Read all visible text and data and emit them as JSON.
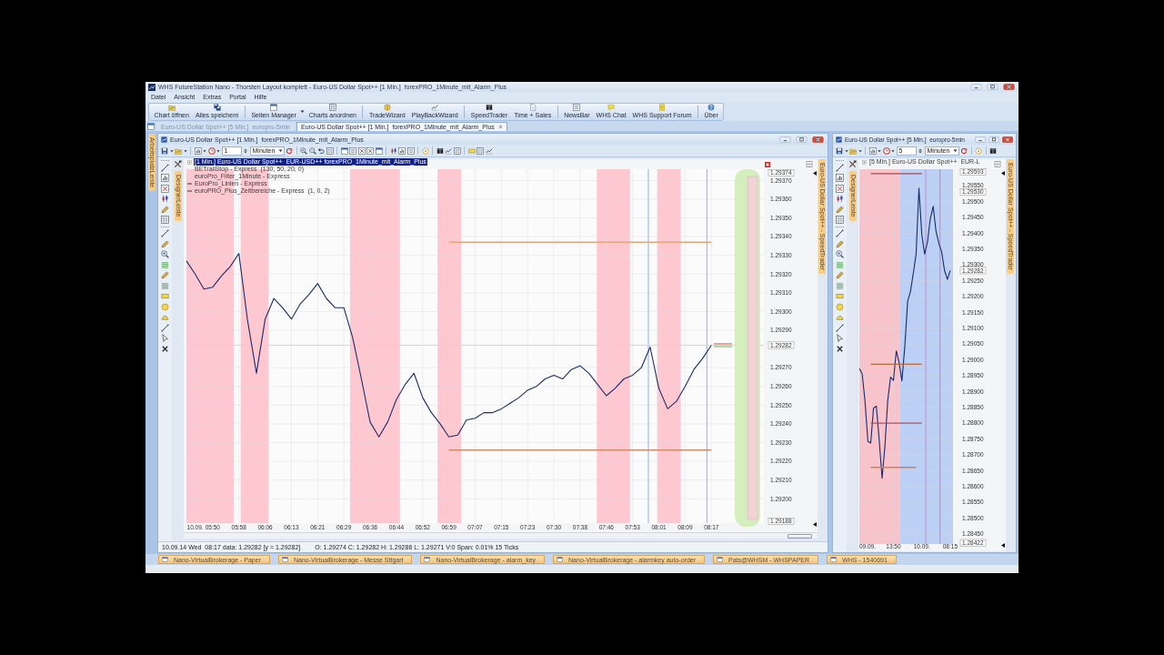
{
  "window": {
    "title": "WHS FutureStation Nano - Thorsten Layout komplett - Euro-US Dollar Spot++ [1 Min.]  forexPRO_1Minute_mit_Alarm_Plus"
  },
  "menu": [
    "Datei",
    "Ansicht",
    "Extras",
    "Portal",
    "Hilfe"
  ],
  "toolbar": [
    {
      "items": [
        {
          "label": "Chart öffnen",
          "dropdown": false
        },
        {
          "label": "Alles speichern",
          "dropdown": false
        }
      ]
    },
    {
      "items": [
        {
          "label": "Seiten Manager",
          "dropdown": true
        },
        {
          "label": "Charts anordnen",
          "dropdown": false
        }
      ]
    },
    {
      "items": [
        {
          "label": "TradeWizard",
          "dropdown": false
        },
        {
          "label": "PlayBackWizard",
          "dropdown": false
        }
      ]
    },
    {
      "items": [
        {
          "label": "SpeedTrader",
          "dropdown": false
        },
        {
          "label": "Time + Sales",
          "dropdown": false
        }
      ]
    },
    {
      "items": [
        {
          "label": "NewsBar",
          "dropdown": false
        },
        {
          "label": "WHS Chat",
          "dropdown": false
        },
        {
          "label": "WHS Support Forum",
          "dropdown": false
        }
      ]
    },
    {
      "items": [
        {
          "label": "Über",
          "dropdown": false
        }
      ]
    }
  ],
  "tabs": [
    {
      "label": "Euro-US Dollar Spot++ [5 Min.]  europro-5min",
      "selected": false
    },
    {
      "label": "Euro-US Dollar Spot++ [1 Min.]  forexPRO_1Minute_mit_Alarm_Plus",
      "selected": true
    }
  ],
  "workspace_bar": {
    "label": "ArbeitsplatzLeiste"
  },
  "charts": [
    {
      "title": "Euro-US Dollar Spot++ [1 Min.]  forexPRO_1Minute_mit_Alarm_Plus",
      "interval": "1",
      "unit": "Minuten",
      "designer_tab": "DesignerLeiste",
      "side_tab": "Euro-US Dollar Spot++ - SpeedTrader",
      "ladder": true,
      "legend": [
        {
          "kind": "instrument",
          "text": "[1 Min.] Euro-US Dollar Spot++  EUR-USD++ forexPRO_1Minute_mit_Alarm_Plus",
          "selected": true,
          "swatch": false
        },
        {
          "kind": "indicator",
          "text": "BETrailStop - Express  (130, 50, 20, 0)",
          "selected": false,
          "swatch": false
        },
        {
          "kind": "indicator",
          "text": "euroPro_Filter_1Minute - Express",
          "selected": false,
          "swatch": false
        },
        {
          "kind": "indicator",
          "text": "EuroPro_Linien - Express",
          "selected": false,
          "swatch": true
        },
        {
          "kind": "indicator",
          "text": "euroPRO_Plus_Zeitbereiche - Express  (1, 0, 2)",
          "selected": false,
          "swatch": true
        }
      ],
      "chart_data": {
        "type": "line",
        "grid": true,
        "categories": [
          null,
          "10.09.",
          null,
          "05:50",
          null,
          null,
          "05:58",
          null,
          null,
          "06:06",
          null,
          null,
          "06:13",
          null,
          null,
          "06:21",
          null,
          null,
          "06:29",
          null,
          null,
          "06:36",
          null,
          null,
          "06:44",
          null,
          null,
          "06:52",
          null,
          null,
          "06:59",
          null,
          null,
          "07:07",
          null,
          null,
          "07:15",
          null,
          null,
          "07:23",
          null,
          null,
          "07:30",
          null,
          null,
          "07:38",
          null,
          null,
          "07:46",
          null,
          null,
          "07:53",
          null,
          null,
          "08:01",
          null,
          null,
          "08:09",
          null,
          null,
          "08:17",
          null,
          null,
          null,
          null,
          null,
          null
        ],
        "series": [
          {
            "color": "#1b2b6b",
            "values": [
              1.29327,
              1.2932,
              1.29312,
              1.29313,
              1.29319,
              1.29324,
              1.29331,
              1.29295,
              1.29267,
              1.29296,
              1.29307,
              1.29302,
              1.29296,
              1.29304,
              1.29309,
              1.29315,
              1.29307,
              1.29302,
              1.29302,
              1.29286,
              1.29264,
              1.29241,
              1.29233,
              1.29241,
              1.29253,
              1.29261,
              1.29267,
              1.29254,
              1.29246,
              1.2924,
              1.29233,
              1.29234,
              1.29242,
              1.29243,
              1.29246,
              1.29246,
              1.29248,
              1.29251,
              1.29254,
              1.29258,
              1.2926,
              1.29264,
              1.29266,
              1.29264,
              1.29269,
              1.29271,
              1.29267,
              1.29261,
              1.29255,
              1.29259,
              1.29264,
              1.29266,
              1.2927,
              1.29281,
              1.29259,
              1.29248,
              1.29252,
              1.2926,
              1.29269,
              1.29275,
              1.29282,
              null,
              null,
              null,
              null,
              null,
              null
            ]
          },
          {
            "color": "#e3a77a",
            "values": [
              null,
              null,
              null,
              null,
              null,
              null,
              null,
              null,
              null,
              null,
              null,
              null,
              null,
              null,
              null,
              null,
              null,
              null,
              null,
              null,
              null,
              null,
              null,
              null,
              null,
              null,
              null,
              null,
              null,
              null,
              1.29337,
              1.29337,
              1.29337,
              1.29337,
              1.29337,
              1.29337,
              1.29337,
              1.29337,
              1.29337,
              1.29337,
              1.29337,
              1.29337,
              1.29337,
              1.29337,
              1.29337,
              1.29337,
              1.29337,
              1.29337,
              1.29337,
              1.29337,
              1.29337,
              1.29337,
              1.29337,
              1.29337,
              1.29337,
              1.29337,
              1.29337,
              1.29337,
              1.29337,
              1.29337,
              1.29337,
              null,
              null,
              null,
              null,
              null,
              null
            ]
          },
          {
            "color": "#d98a5a",
            "values": [
              null,
              null,
              null,
              null,
              null,
              null,
              null,
              null,
              null,
              null,
              null,
              null,
              null,
              null,
              null,
              null,
              null,
              null,
              null,
              null,
              null,
              null,
              null,
              null,
              null,
              null,
              null,
              null,
              null,
              null,
              1.29226,
              1.29226,
              1.29226,
              1.29226,
              1.29226,
              1.29226,
              1.29226,
              1.29226,
              1.29226,
              1.29226,
              1.29226,
              1.29226,
              1.29226,
              1.29226,
              1.29226,
              1.29226,
              1.29226,
              1.29226,
              1.29226,
              1.29226,
              1.29226,
              1.29226,
              1.29226,
              1.29226,
              1.29226,
              1.29226,
              1.29226,
              1.29226,
              1.29226,
              1.29226,
              1.29226,
              null,
              null,
              null,
              null,
              null,
              null
            ]
          }
        ],
        "ylim": [
          1.29187,
          1.29376
        ],
        "yticks": [
          {
            "value": 1.2937,
            "label": "1.29370"
          },
          {
            "value": 1.2936,
            "label": "1.29360"
          },
          {
            "value": 1.2935,
            "label": "1.29350"
          },
          {
            "value": 1.2934,
            "label": "1.29340"
          },
          {
            "value": 1.2933,
            "label": "1.29330"
          },
          {
            "value": 1.2932,
            "label": "1.29320"
          },
          {
            "value": 1.2931,
            "label": "1.29310"
          },
          {
            "value": 1.293,
            "label": "1.29300"
          },
          {
            "value": 1.2929,
            "label": "1.29290"
          },
          {
            "value": 1.2927,
            "label": "1.29270"
          },
          {
            "value": 1.2926,
            "label": "1.29260"
          },
          {
            "value": 1.2925,
            "label": "1.29250"
          },
          {
            "value": 1.2924,
            "label": "1.29240"
          },
          {
            "value": 1.2923,
            "label": "1.29230"
          },
          {
            "value": 1.2922,
            "label": "1.29220"
          },
          {
            "value": 1.2921,
            "label": "1.29210"
          },
          {
            "value": 1.292,
            "label": "1.29200"
          }
        ],
        "ref_lines": [
          {
            "axis": "y",
            "value": 1.29282,
            "color": "#f5cdb5"
          }
        ],
        "annotations": [
          "1.29374",
          "1.29282",
          "1.29188"
        ]
      },
      "status": {
        "cursor": "10.09.14 Wed  08:17 data: 1.29282 [y = 1.29282]",
        "bar": "O: 1.29274 C: 1.29282 H: 1.29286 L: 1.29271 V:0 Span: 0.01% 15 Ticks"
      }
    },
    {
      "title": "Euro-US Dollar Spot++ [5 Min.]  europro-5min",
      "interval": "5",
      "unit": "Minuten",
      "designer_tab": "DesignerLeiste",
      "side_tab": "Euro-US Dollar Spot++ - SpeedTrader",
      "ladder": false,
      "legend": [
        {
          "kind": "instrument",
          "text": "[5 Min.] Euro-US Dollar Spot++  EUR-L",
          "selected": false,
          "swatch": false
        }
      ],
      "chart_data": {
        "type": "line",
        "grid": true,
        "categories": [
          null,
          null,
          "09.09.",
          null,
          null,
          null,
          null,
          null,
          null,
          null,
          null,
          null,
          "13:50",
          null,
          null,
          null,
          null,
          null,
          null,
          null,
          null,
          null,
          "10.09.",
          null,
          null,
          null,
          null,
          null,
          null,
          null,
          null,
          null,
          "08:15",
          null
        ],
        "series": [
          {
            "color": "#1b2b6b",
            "values": [
              1.28972,
              1.28956,
              1.2887,
              1.28742,
              1.28737,
              1.28848,
              1.28853,
              1.28748,
              1.28626,
              1.28727,
              1.28871,
              1.28945,
              1.28935,
              1.29028,
              1.28992,
              1.28933,
              1.29039,
              1.29185,
              1.29215,
              1.29273,
              1.29334,
              1.29542,
              1.29395,
              1.29334,
              1.29372,
              1.29445,
              1.29485,
              1.29406,
              1.29368,
              1.29341,
              1.29283,
              1.29254,
              1.29282,
              null
            ]
          },
          {
            "color": "#b24848",
            "values": [
              null,
              null,
              null,
              null,
              1.29588,
              1.29588,
              1.29588,
              1.29588,
              1.29588,
              1.29588,
              1.29588,
              1.29588,
              1.29588,
              1.29588,
              1.29588,
              1.29588,
              1.29588,
              1.29588,
              1.29588,
              1.29588,
              1.29588,
              1.29588,
              1.29588,
              null,
              null,
              null,
              null,
              null,
              null,
              null,
              null,
              null,
              null,
              null
            ]
          },
          {
            "color": "#b06a48",
            "values": [
              null,
              null,
              null,
              null,
              1.28986,
              1.28986,
              1.28986,
              1.28986,
              1.28986,
              1.28986,
              1.28986,
              1.28986,
              1.28986,
              1.28986,
              1.28986,
              1.28986,
              1.28986,
              1.28986,
              1.28986,
              1.28986,
              1.28986,
              1.28986,
              1.28986,
              null,
              null,
              null,
              null,
              null,
              null,
              null,
              null,
              null,
              null,
              null
            ]
          },
          {
            "color": "#a8506a",
            "values": [
              null,
              null,
              null,
              null,
              1.288,
              1.288,
              1.288,
              1.288,
              1.288,
              1.288,
              1.288,
              1.288,
              1.288,
              1.288,
              1.288,
              1.288,
              1.288,
              1.288,
              1.288,
              1.288,
              1.288,
              1.288,
              1.288,
              null,
              null,
              null,
              null,
              null,
              null,
              null,
              null,
              null,
              null,
              null
            ]
          },
          {
            "color": "#c8845a",
            "values": [
              null,
              null,
              null,
              null,
              1.2866,
              1.2866,
              1.2866,
              1.2866,
              1.2866,
              1.2866,
              1.2866,
              1.2866,
              1.2866,
              1.2866,
              1.2866,
              1.2866,
              1.2866,
              1.2866,
              1.2866,
              1.2866,
              1.2866,
              null,
              null,
              null,
              null,
              null,
              null,
              null,
              null,
              null,
              null,
              null,
              null,
              null
            ]
          }
        ],
        "ylim": [
          1.28418,
          1.29602
        ],
        "yticks": [
          {
            "value": 1.2955,
            "label": "1.29550"
          },
          {
            "value": 1.295,
            "label": "1.29500"
          },
          {
            "value": 1.2945,
            "label": "1.29450"
          },
          {
            "value": 1.294,
            "label": "1.29400"
          },
          {
            "value": 1.2935,
            "label": "1.29350"
          },
          {
            "value": 1.293,
            "label": "1.29300"
          },
          {
            "value": 1.2925,
            "label": "1.29250"
          },
          {
            "value": 1.292,
            "label": "1.29200"
          },
          {
            "value": 1.2915,
            "label": "1.29150"
          },
          {
            "value": 1.291,
            "label": "1.29100"
          },
          {
            "value": 1.2905,
            "label": "1.29050"
          },
          {
            "value": 1.29,
            "label": "1.29000"
          },
          {
            "value": 1.2895,
            "label": "1.28950"
          },
          {
            "value": 1.289,
            "label": "1.28900"
          },
          {
            "value": 1.2885,
            "label": "1.28850"
          },
          {
            "value": 1.288,
            "label": "1.28800"
          },
          {
            "value": 1.2875,
            "label": "1.28750"
          },
          {
            "value": 1.287,
            "label": "1.28700"
          },
          {
            "value": 1.2865,
            "label": "1.28650"
          },
          {
            "value": 1.286,
            "label": "1.28600"
          },
          {
            "value": 1.2855,
            "label": "1.28550"
          },
          {
            "value": 1.285,
            "label": "1.28500"
          },
          {
            "value": 1.2845,
            "label": "1.28450"
          }
        ],
        "annotations": [
          "1.29593",
          "1.29530",
          "1.29282",
          "1.28422"
        ]
      }
    }
  ],
  "taskbar": [
    "Nano-VirtualBrokerage - Paper",
    "Nano-VirtualBrokerage - Messe Sttgart",
    "Nano-VirtualBrokerage - alarm_key",
    "Nano-VirtualBrokerage - alarmkey auto-order",
    "Pats@WHSM - WHSPAPER",
    "WHS - 1540691"
  ]
}
